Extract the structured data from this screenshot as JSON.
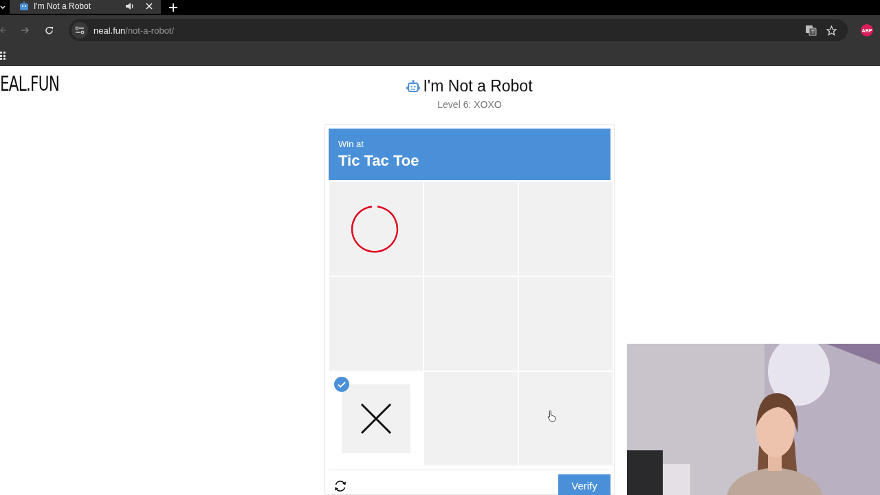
{
  "browser": {
    "tab": {
      "title": "I'm Not a Robot"
    },
    "address": {
      "domain": "neal.fun",
      "path": "/not-a-robot/"
    },
    "extension_badge": "ABP"
  },
  "site_logo": "EAL.FUN",
  "header": {
    "title": "I'm Not a Robot",
    "subtitle": "Level 6: XOXO"
  },
  "challenge": {
    "prompt": "Win at",
    "game": "Tic Tac Toe",
    "verify_button": "Verify",
    "cells": [
      {
        "kind": "o",
        "selected": false
      },
      {
        "kind": "empty",
        "selected": false
      },
      {
        "kind": "empty",
        "selected": false
      },
      {
        "kind": "empty",
        "selected": false
      },
      {
        "kind": "empty",
        "selected": false
      },
      {
        "kind": "empty",
        "selected": false
      },
      {
        "kind": "x",
        "selected": true
      },
      {
        "kind": "empty",
        "selected": false
      },
      {
        "kind": "empty",
        "selected": false
      }
    ]
  }
}
